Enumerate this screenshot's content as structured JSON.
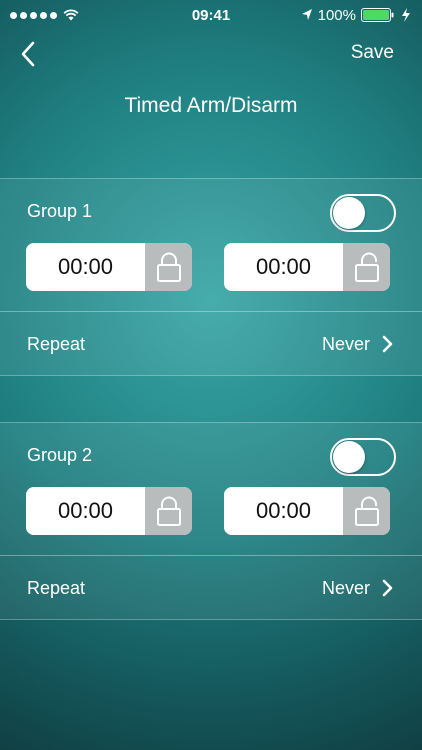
{
  "status_bar": {
    "time": "09:41",
    "battery": "100%"
  },
  "nav": {
    "save_label": "Save",
    "title": "Timed Arm/Disarm"
  },
  "groups": [
    {
      "label": "Group 1",
      "enabled": false,
      "arm_time": "00:00",
      "disarm_time": "00:00",
      "repeat_label": "Repeat",
      "repeat_value": "Never"
    },
    {
      "label": "Group 2",
      "enabled": false,
      "arm_time": "00:00",
      "disarm_time": "00:00",
      "repeat_label": "Repeat",
      "repeat_value": "Never"
    }
  ],
  "icons": {
    "back": "chevron-left-icon",
    "arm": "lock-closed-icon",
    "disarm": "lock-open-icon",
    "repeat": "chevron-right-icon"
  },
  "colors": {
    "lock_button_bg": "#b9bcbd",
    "battery_fill": "#4cd964"
  }
}
